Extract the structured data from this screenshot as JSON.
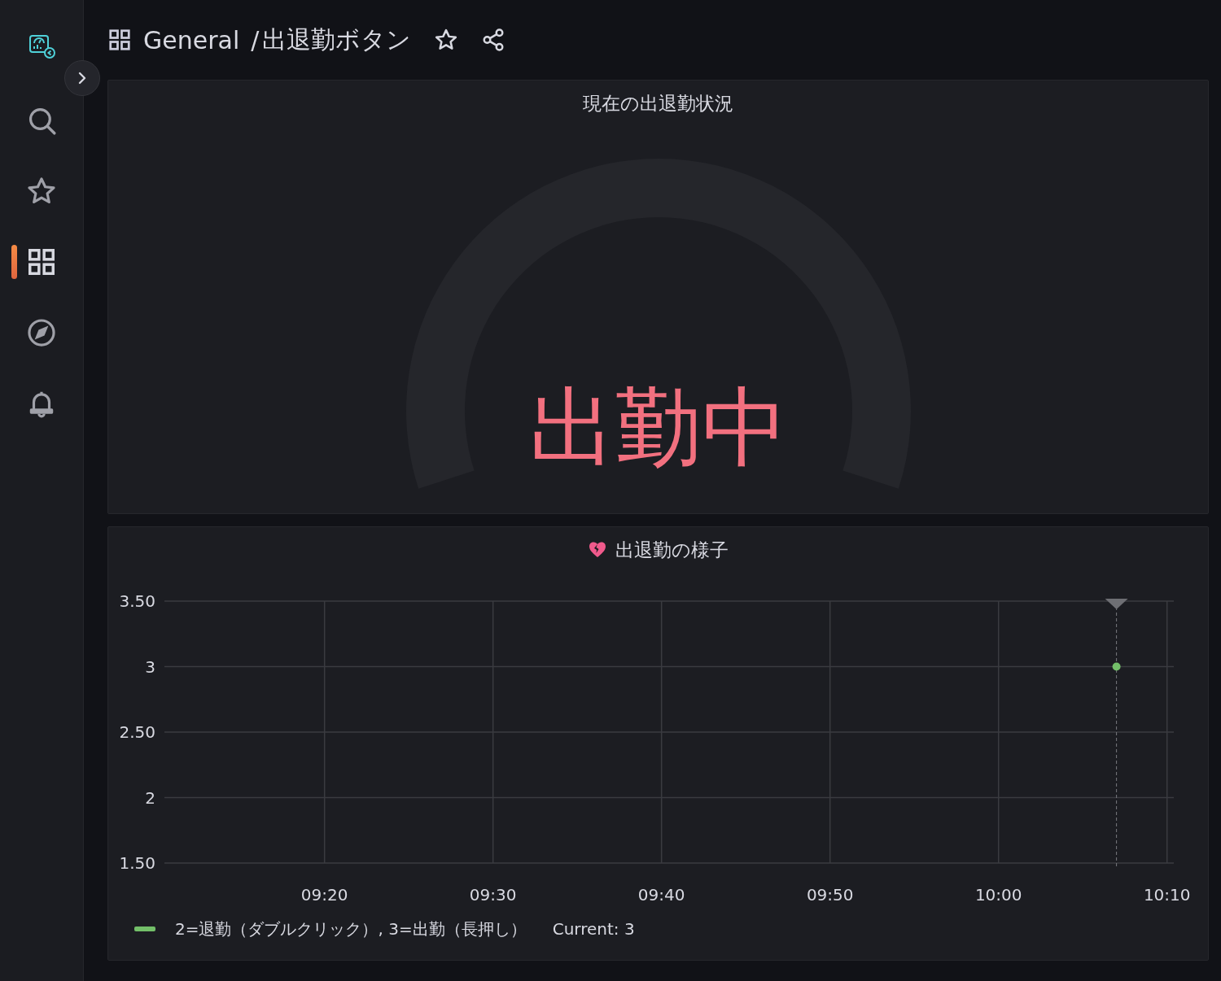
{
  "sidebar": {
    "items": [
      {
        "kind": "search",
        "selected": false
      },
      {
        "kind": "star",
        "selected": false
      },
      {
        "kind": "dashboards",
        "selected": true
      },
      {
        "kind": "explore",
        "selected": false
      },
      {
        "kind": "alerting",
        "selected": false
      }
    ]
  },
  "breadcrumb": {
    "folder": "General",
    "separator": "/",
    "title": "出退勤ボタン"
  },
  "panels": [
    {
      "kind": "gauge",
      "title": "現在の出退勤状況",
      "value_text": "出勤中"
    },
    {
      "kind": "timeseries",
      "title": "出退勤の様子",
      "chart_data": {
        "type": "scatter",
        "x": [
          607
        ],
        "series": [
          {
            "name": "2=退勤（ダブルクリック）, 3=出勤（長押し）",
            "color": "#73bf69",
            "values": [
              3
            ]
          }
        ],
        "grid": true,
        "ref_lines": [
          {
            "axis": "x",
            "value": 607
          }
        ],
        "xlim": [
          550.5,
          610.4
        ],
        "ylim": [
          1.5,
          3.5
        ],
        "xticks": [
          {
            "value": 560,
            "label": "09:20"
          },
          {
            "value": 570,
            "label": "09:30"
          },
          {
            "value": 580,
            "label": "09:40"
          },
          {
            "value": 590,
            "label": "09:50"
          },
          {
            "value": 600,
            "label": "10:00"
          },
          {
            "value": 610,
            "label": "10:10"
          }
        ],
        "yticks": [
          {
            "value": 1.5,
            "label": "1.50"
          },
          {
            "value": 2,
            "label": "2"
          },
          {
            "value": 2.5,
            "label": "2.50"
          },
          {
            "value": 3,
            "label": "3"
          },
          {
            "value": 3.5,
            "label": "3.50"
          }
        ]
      },
      "legend_current": "Current: 3"
    }
  ]
}
